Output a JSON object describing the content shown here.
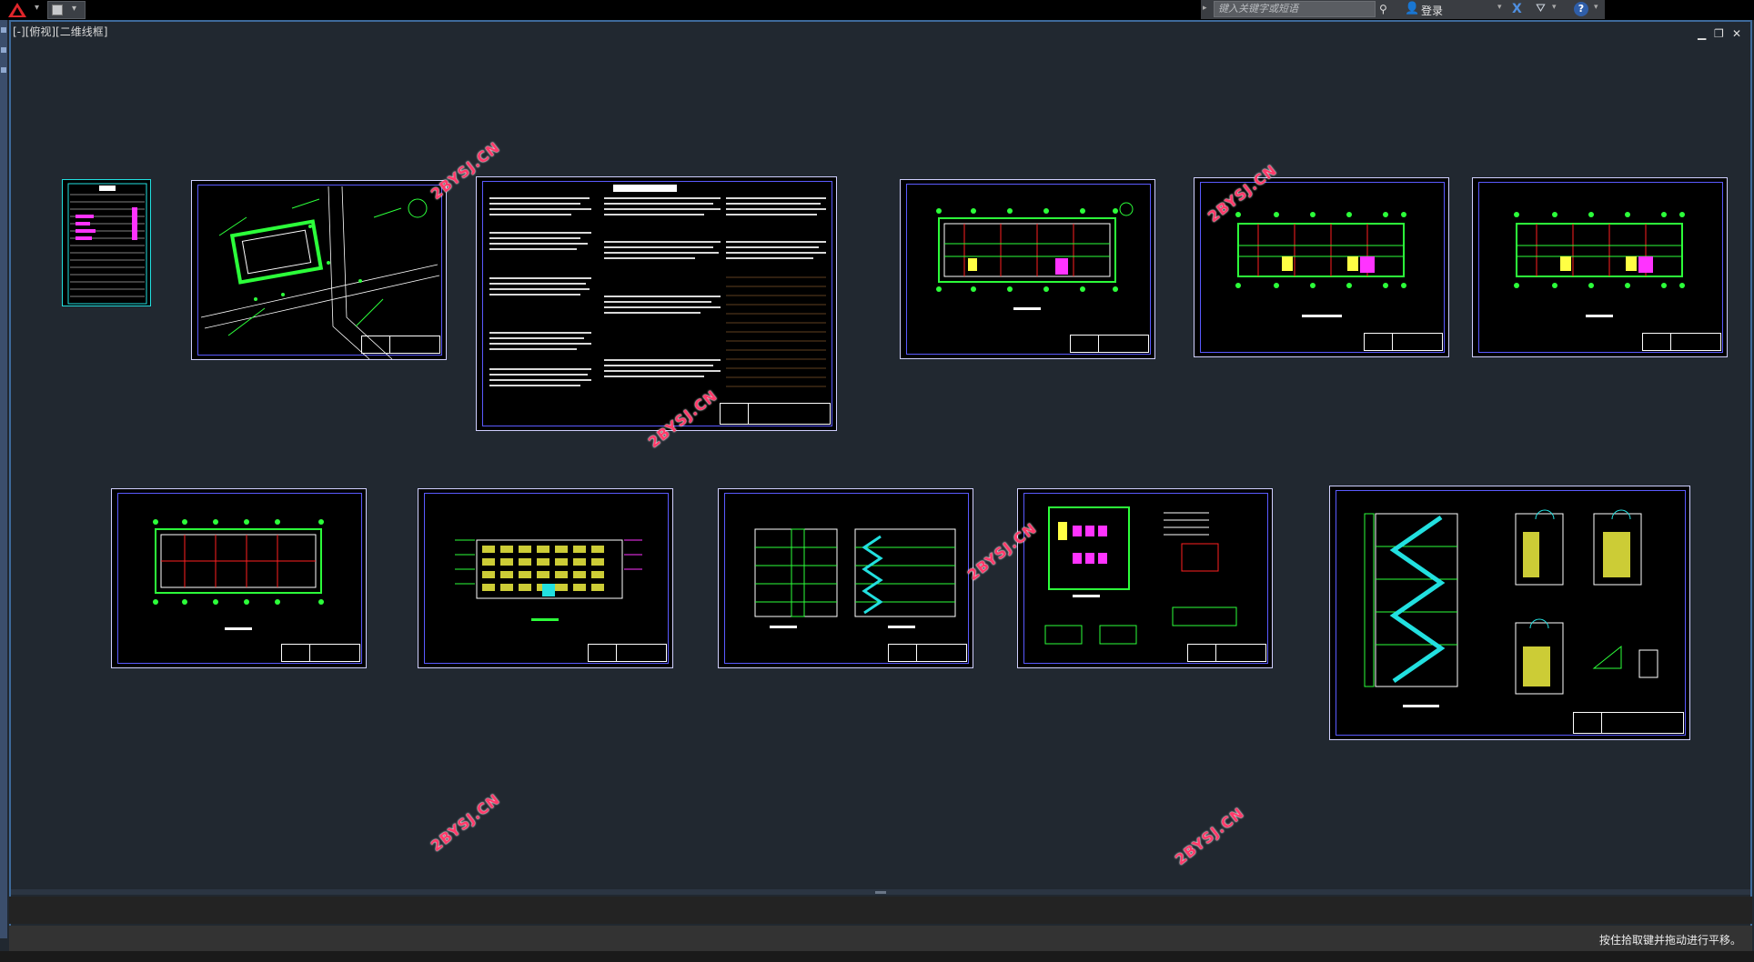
{
  "toolbar": {
    "search_placeholder": "键入关键字或短语",
    "login_label": "登录"
  },
  "viewport": {
    "label": "[-][俯视][二维线框]"
  },
  "status": {
    "message": "按住拾取键并拖动进行平移。"
  },
  "watermark_text": "2BYSJ.CN",
  "drawings": [
    {
      "name": "图纸目录"
    },
    {
      "name": "总平面图"
    },
    {
      "name": "建筑设计说明"
    },
    {
      "name": "一层平面图"
    },
    {
      "name": "二层平面图"
    },
    {
      "name": "三层平面图"
    },
    {
      "name": "屋顶平面图"
    },
    {
      "name": "立面图"
    },
    {
      "name": "立剖面图"
    },
    {
      "name": "卫生间详图"
    },
    {
      "name": "楼梯详图"
    }
  ],
  "colors": {
    "background": "#212830",
    "line_green": "#2cff3a",
    "line_cyan": "#22e0e0",
    "line_red": "#ff2020",
    "line_magenta": "#ff33ff",
    "line_yellow": "#ffff44",
    "watermark": "#ff3b6b"
  }
}
